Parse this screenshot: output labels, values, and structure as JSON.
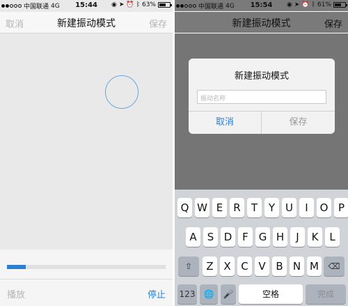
{
  "left": {
    "status": {
      "carrier": "中国联通",
      "network": "4G",
      "time": "15:44",
      "battery": "63%",
      "battery_level": 0.63
    },
    "nav": {
      "left": "取消",
      "title": "新建振动模式",
      "right": "保存"
    },
    "progress": 0.12,
    "bottom": {
      "play": "播放",
      "stop": "停止"
    }
  },
  "right": {
    "status": {
      "carrier": "中国联通",
      "network": "4G",
      "time": "15:54",
      "battery": "61%",
      "battery_level": 0.61
    },
    "nav": {
      "title": "新建振动模式",
      "right": "保存"
    },
    "dialog": {
      "title": "新建振动模式",
      "input_placeholder": "振动名称",
      "cancel": "取消",
      "save": "保存"
    },
    "keyboard": {
      "row1": [
        "Q",
        "W",
        "E",
        "R",
        "T",
        "Y",
        "U",
        "I",
        "O",
        "P"
      ],
      "row2": [
        "A",
        "S",
        "D",
        "F",
        "G",
        "H",
        "J",
        "K",
        "L"
      ],
      "row3": [
        "Z",
        "X",
        "C",
        "V",
        "B",
        "N",
        "M"
      ],
      "shift_icon": "shift-arrow-icon",
      "delete_icon": "backspace-icon",
      "num_key": "123",
      "globe_icon": "globe-icon",
      "mic_icon": "microphone-icon",
      "space": "空格",
      "done": "完成"
    }
  },
  "colors": {
    "accent": "#2d7fd3",
    "dim": "#757575",
    "keyboard_bg": "#d0d3d8"
  }
}
